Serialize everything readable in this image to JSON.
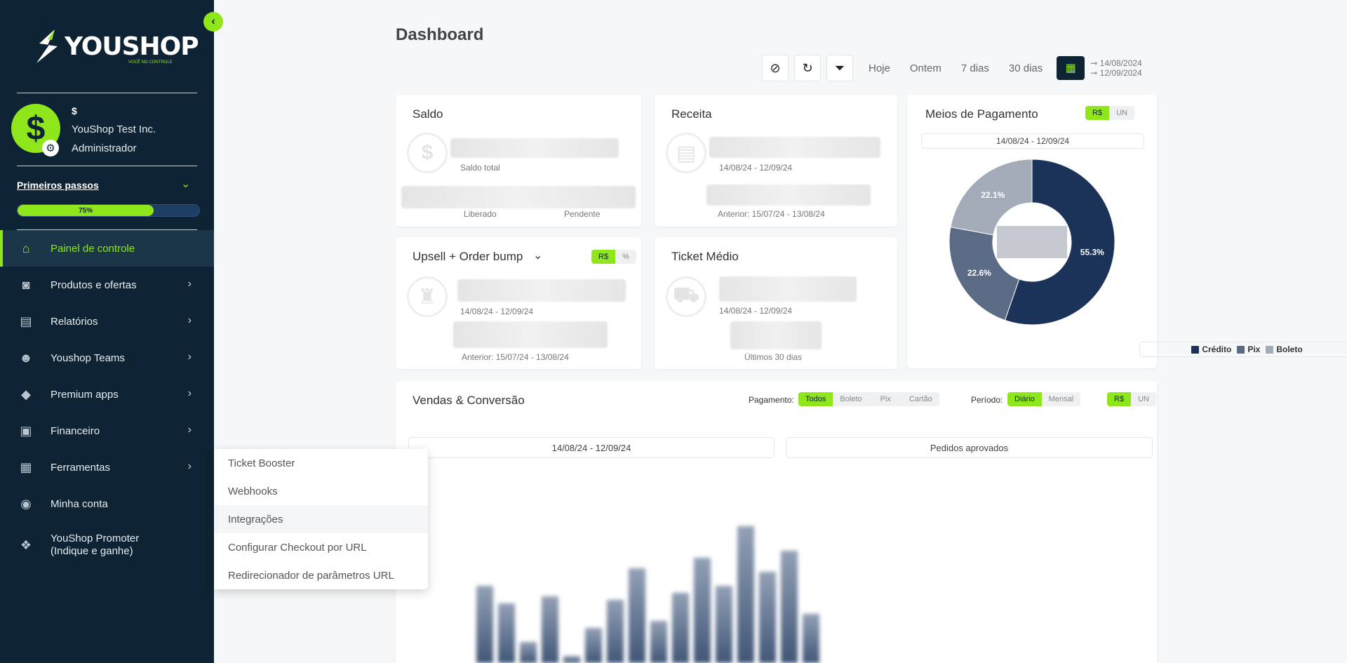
{
  "sidebar": {
    "logo_text": "YOUSHOP",
    "logo_sub": "VOCÊ NO CONTROLE",
    "user": {
      "dollar": "$",
      "company": "YouShop Test Inc.",
      "role": "Administrador"
    },
    "first_steps": {
      "label": "Primeiros passos",
      "progress_label": "75%",
      "progress": 0.75
    },
    "items": [
      {
        "label": "Painel de controle",
        "icon": "home-icon"
      },
      {
        "label": "Produtos e ofertas",
        "icon": "shopping-bag-icon"
      },
      {
        "label": "Relatórios",
        "icon": "presentation-chart-icon"
      },
      {
        "label": "Youshop Teams",
        "icon": "users-icon"
      },
      {
        "label": "Premium apps",
        "icon": "diamond-icon"
      },
      {
        "label": "Financeiro",
        "icon": "money-icon"
      },
      {
        "label": "Ferramentas",
        "icon": "grid-icon"
      },
      {
        "label": "Minha conta",
        "icon": "user-circle-icon"
      },
      {
        "label": "YouShop Promoter",
        "label2": "(Indique e ganhe)",
        "icon": "gift-icon"
      }
    ]
  },
  "flyout": {
    "items": [
      "Ticket Booster",
      "Webhooks",
      "Integrações",
      "Configurar Checkout por URL",
      "Redirecionador de parâmetros URL"
    ]
  },
  "header": {
    "title": "Dashboard",
    "ranges": [
      "Hoje",
      "Ontem",
      "7 dias",
      "30 dias"
    ],
    "date_from": "14/08/2024",
    "date_to": "12/09/2024"
  },
  "cards": {
    "saldo": {
      "title": "Saldo",
      "total": "Saldo total",
      "liberado": "Liberado",
      "pendente": "Pendente"
    },
    "receita": {
      "title": "Receita",
      "period": "14/08/24 - 12/09/24",
      "previous": "Anterior: 15/07/24 - 13/08/24"
    },
    "upsell": {
      "title": "Upsell + Order bump",
      "toggle": [
        "R$",
        "%"
      ],
      "period": "14/08/24 - 12/09/24",
      "previous": "Anterior: 15/07/24 - 13/08/24"
    },
    "ticket": {
      "title": "Ticket Médio",
      "period": "14/08/24 - 12/09/24",
      "last": "Últimos 30 dias"
    },
    "meios": {
      "title": "Meios de Pagamento",
      "toggle": [
        "R$",
        "UN"
      ],
      "period": "14/08/24 - 12/09/24"
    },
    "vendas": {
      "title": "Vendas & Conversão",
      "pagamento_label": "Pagamento:",
      "pagamento": [
        "Todos",
        "Boleto",
        "Pix",
        "Cartão"
      ],
      "periodo_label": "Período:",
      "periodo": [
        "Diário",
        "Mensal"
      ],
      "unit": [
        "R$",
        "UN"
      ],
      "period": "14/08/24 - 12/09/24",
      "orders": "Pedidos aprovados"
    }
  },
  "chart_data": {
    "type": "pie",
    "categories": [
      "Crédito",
      "Pix",
      "Boleto"
    ],
    "values": [
      55.3,
      22.6,
      22.1
    ],
    "labels": [
      "55.3%",
      "22.6%",
      "22.1%"
    ],
    "colors": [
      "#1c3359",
      "#5b6b85",
      "#a3abb8"
    ],
    "legend": "bottom"
  },
  "colors": {
    "accent": "#8ee61b",
    "sidebar": "#0e2434"
  }
}
